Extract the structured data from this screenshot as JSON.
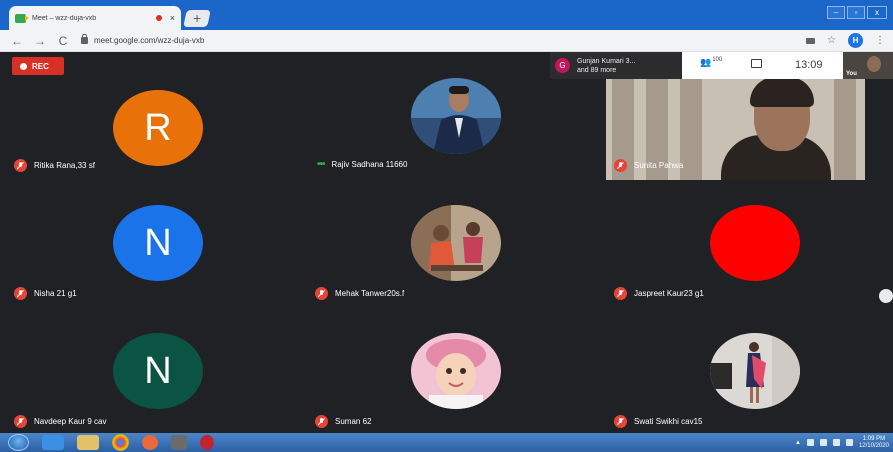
{
  "browser": {
    "tab_title": "Meet – wzz-duja-vxb",
    "tab_close": "×",
    "new_tab": "+",
    "url": "meet.google.com/wzz-duja-vxb",
    "profile_initial": "H",
    "nav": {
      "back": "←",
      "forward": "→",
      "reload": "C"
    },
    "star": "☆",
    "menu": "⋮",
    "window_buttons": {
      "minimize": "–",
      "maximize": "▫",
      "close": "x"
    }
  },
  "meet": {
    "rec_label": "REC",
    "presenter": {
      "initial": "G",
      "line1": "Gunjan Kumari 3...",
      "line2": "and 89 more"
    },
    "people_count": "100",
    "time": "13:09",
    "self_label": "You",
    "participants": [
      {
        "name": "Ritika Rana,33 sf",
        "initial": "R",
        "color": "#e8710a",
        "muted": true
      },
      {
        "name": "Rajiv Sadhana 11660",
        "initial": "",
        "color": "#5a8fc2",
        "muted": false
      },
      {
        "name": "Sunita Pahwa",
        "initial": "",
        "color": "",
        "muted": true
      },
      {
        "name": "Nisha 21 g1",
        "initial": "N",
        "color": "#1a73e8",
        "muted": true
      },
      {
        "name": "Mehak Tanwer20s.f",
        "initial": "",
        "color": "#b89b7e",
        "muted": true
      },
      {
        "name": "Jaspreet Kaur23 g1",
        "initial": "",
        "color": "#ff0000",
        "muted": true
      },
      {
        "name": "Navdeep Kaur 9 cav",
        "initial": "N",
        "color": "#0b5343",
        "muted": true
      },
      {
        "name": "Suman 62",
        "initial": "",
        "color": "#e79bb7",
        "muted": true
      },
      {
        "name": "Swati Swikhi cav15",
        "initial": "",
        "color": "#d6d3cf",
        "muted": true
      }
    ]
  },
  "taskbar": {
    "time": "1:09 PM",
    "date": "12/10/2020"
  }
}
